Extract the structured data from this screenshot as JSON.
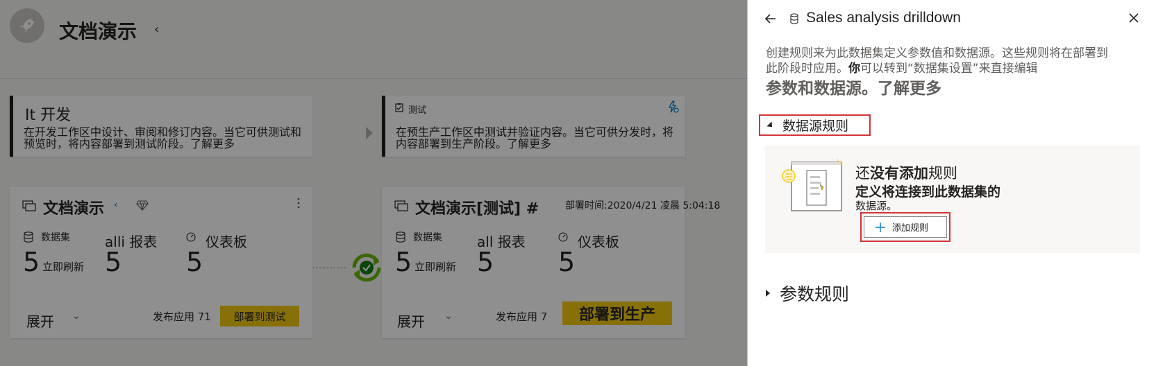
{
  "workspace": {
    "title": "文档演示",
    "title_tail": "‹"
  },
  "stages": [
    {
      "name": "It 开发",
      "description": "在开发工作区中设计、审阅和修订内容。当它可供测试和预览时，将内容部署到测试阶段。了解更多"
    },
    {
      "name": "测试",
      "description": "在预生产工作区中测试并验证内容。当它可供分发时，将内容部署到生产阶段。了解更多"
    }
  ],
  "content_cards": [
    {
      "title": "文档演示",
      "title_tail": "‹",
      "dataset_label": "数据集",
      "dataset_count": "5",
      "refresh_label": "立即刷新",
      "report_label": "alli 报表",
      "report_count": "5",
      "dashboard_label": "仪表板",
      "dashboard_count": "5",
      "expand_label": "展开",
      "publish_label": "发布应用 71",
      "deploy_label": "部署到测试"
    },
    {
      "title": "文档演示[测试] #",
      "deploy_time": "部署时间:2020/4/21 凌晨 5:04:18",
      "dataset_label": "数据集",
      "dataset_count": "5",
      "refresh_label": "立即刷新",
      "report_label": "all 报表",
      "report_count": "5",
      "dashboard_label": "仪表板",
      "dashboard_count": "5",
      "expand_label": "展开",
      "publish_label": "发布应用 7",
      "deploy_label": "部署到生产"
    }
  ],
  "panel": {
    "title": "Sales analysis drilldown",
    "desc_line1": "创建规则来为此数据集定义参数值和数据源。这些规则将在部署到",
    "desc_line2a": "此阶段时应用。",
    "desc_line2b": "你",
    "desc_line2c": "可以转到“数据集设置”来直接编辑",
    "learn_more": "参数和数据源。了解更多",
    "datasource_rules_label": "数据源规则",
    "empty_title_a": "还",
    "empty_title_b": "没有添加",
    "empty_title_c": "规则",
    "empty_sub": "定义将连接到此数据集的",
    "empty_sub2": "数据源。",
    "add_rule_label": "添加规则",
    "param_rules_label": "参数规则"
  },
  "colors": {
    "accent_yellow": "#f2c811",
    "highlight_red": "#d13438",
    "success_green": "#107c10",
    "sync_green": "#6bb700"
  }
}
